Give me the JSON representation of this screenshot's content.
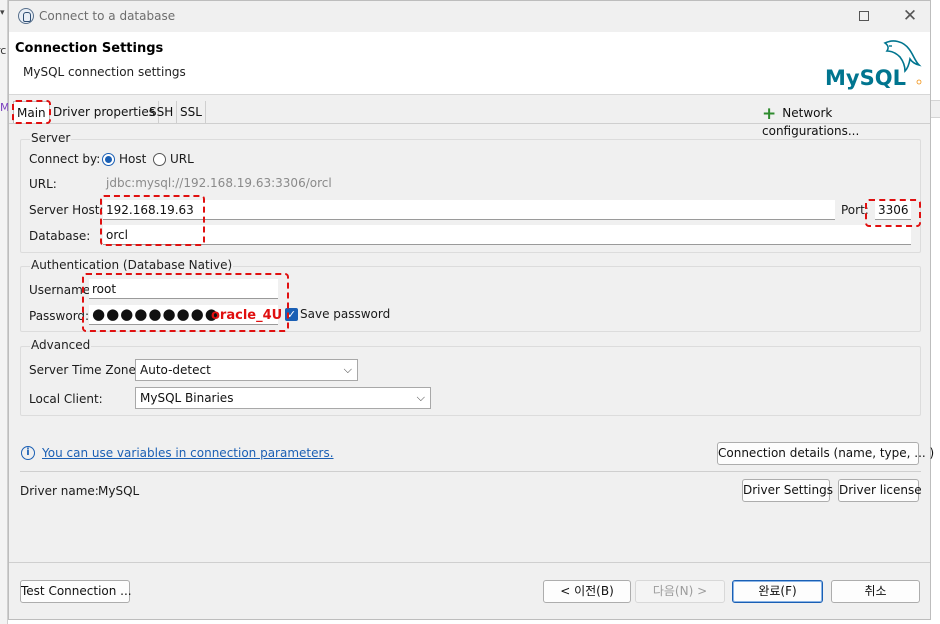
{
  "background": {
    "edge_text_1": "▾",
    "edge_text_2": "rc",
    "edge_text_3": "M"
  },
  "window": {
    "title": "Connect to a database",
    "maximize_icon": "maximize-icon",
    "close_glyph": "✕"
  },
  "header": {
    "title": "Connection Settings",
    "subtitle": "MySQL connection settings",
    "logo_text": "MySQL"
  },
  "tabs": [
    {
      "label": "Main",
      "active": true
    },
    {
      "label": "Driver properties",
      "active": false
    },
    {
      "label": "SSH",
      "active": false
    },
    {
      "label": "SSL",
      "active": false
    }
  ],
  "network_config": {
    "plus": "+",
    "label": "Network configurations..."
  },
  "server": {
    "group_title": "Server",
    "connect_by_label": "Connect by:",
    "option_host": "Host",
    "option_url": "URL",
    "selected": "Host",
    "url_label": "URL:",
    "url_value": "jdbc:mysql://192.168.19.63:3306/orcl",
    "host_label": "Server Host:",
    "host_value": "192.168.19.63",
    "port_label": "Port:",
    "port_value": "3306",
    "database_label": "Database:",
    "database_value": "orcl"
  },
  "auth": {
    "group_title": "Authentication (Database Native)",
    "username_label": "Username:",
    "username_value": "root",
    "password_label": "Password:",
    "password_masked": "●●●●●●●●●",
    "password_annotation": "oracle_4U",
    "save_password_label": "Save password",
    "save_password_checked": true,
    "check_glyph": "✓"
  },
  "advanced": {
    "group_title": "Advanced",
    "timezone_label": "Server Time Zone:",
    "timezone_value": "Auto-detect",
    "local_client_label": "Local Client:",
    "local_client_value": "MySQL Binaries",
    "chevron": "⌵"
  },
  "info": {
    "icon_glyph": "i",
    "link_text": "You can use variables in connection parameters."
  },
  "connection_details_button": "Connection details (name, type, ... )",
  "driver": {
    "name_label": "Driver name:",
    "name_value": "MySQL",
    "settings_button": "Driver Settings",
    "license_button": "Driver license"
  },
  "footer": {
    "test_button": "Test Connection ...",
    "back_button": "< 이전(B)",
    "next_button": "다음(N) >",
    "finish_button": "완료(F)",
    "cancel_button": "취소"
  },
  "colors": {
    "accent": "#1a5fb4",
    "annotation": "#e01010",
    "mysql_teal": "#00758f",
    "mysql_orange": "#f29111"
  }
}
